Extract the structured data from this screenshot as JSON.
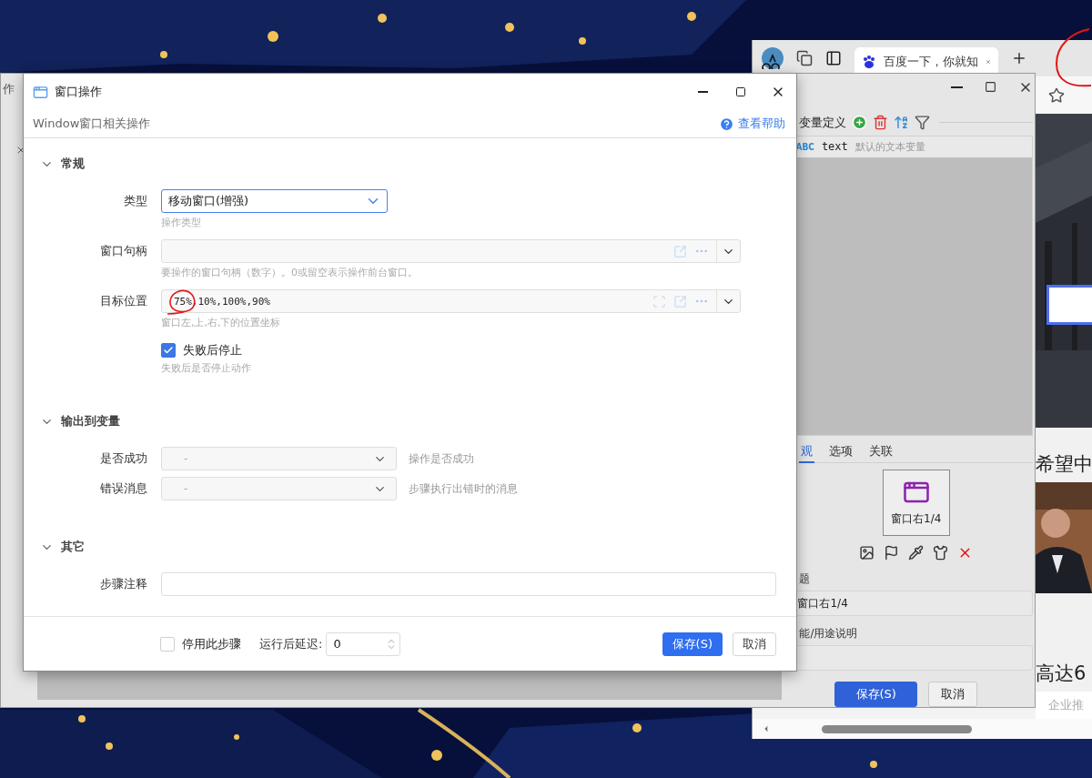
{
  "desktop": {
    "kind": "picture"
  },
  "browser": {
    "tab": {
      "title": "百度一下，你就知",
      "selected": true
    },
    "circled_corner": true,
    "page": {
      "hero": {
        "kind": "picture"
      },
      "photo": {
        "kind": "picture"
      },
      "fragments": [
        "希望中",
        "高达6"
      ],
      "footer_fragment": "企业推"
    }
  },
  "editor": {
    "edge_text": "作",
    "variables": {
      "title": "变量定义",
      "items": [
        {
          "type": "ABC",
          "name": "text",
          "description": "默认的文本变量"
        }
      ]
    },
    "tabs": [
      {
        "label": "观",
        "selected": true
      },
      {
        "label": "选项",
        "selected": false
      },
      {
        "label": "关联",
        "selected": false
      }
    ],
    "preview": {
      "label": "窗口右1/4"
    },
    "fields": [
      {
        "label": "题",
        "value": "窗口右1/4"
      },
      {
        "label": "能/用途说明"
      }
    ],
    "buttons": [
      {
        "label": "保存(S)",
        "primary": true
      },
      {
        "label": "取消",
        "primary": false
      }
    ]
  },
  "dialog": {
    "title": "窗口操作",
    "subtitle": "Window窗口相关操作",
    "help_link": "查看帮助",
    "sections": [
      {
        "title": "常规",
        "expanded": true,
        "rows": [
          {
            "kind": "select",
            "label": "类型",
            "value": "移动窗口(增强)",
            "hint": "操作类型",
            "focused": true
          },
          {
            "kind": "expression",
            "label": "窗口句柄",
            "hint": "要操作的窗口句柄（数字）。0或留空表示操作前台窗口。",
            "capture_button": false,
            "circled": false
          },
          {
            "kind": "expression",
            "label": "目标位置",
            "value": "75%,10%,100%,90%",
            "hint": "窗口左,上,右,下的位置坐标",
            "capture_button": true,
            "circled": true
          },
          {
            "kind": "checkbox",
            "label": "失败后停止",
            "checked": true,
            "hint": "失败后是否停止动作"
          }
        ]
      },
      {
        "title": "输出到变量",
        "expanded": true,
        "rows": [
          {
            "kind": "variable",
            "label": "是否成功",
            "value": "-",
            "note": "操作是否成功"
          },
          {
            "kind": "variable",
            "label": "错误消息",
            "value": "-",
            "note": "步骤执行出错时的消息"
          }
        ]
      },
      {
        "title": "其它",
        "expanded": true,
        "rows": [
          {
            "kind": "text",
            "label": "步骤注释"
          }
        ]
      }
    ],
    "footer": {
      "disable_step": {
        "label": "停用此步骤",
        "checked": false
      },
      "delay": {
        "label": "运行后延迟:",
        "value": "0"
      },
      "buttons": [
        {
          "label": "保存(S)",
          "primary": true
        },
        {
          "label": "取消",
          "primary": false
        }
      ]
    }
  }
}
